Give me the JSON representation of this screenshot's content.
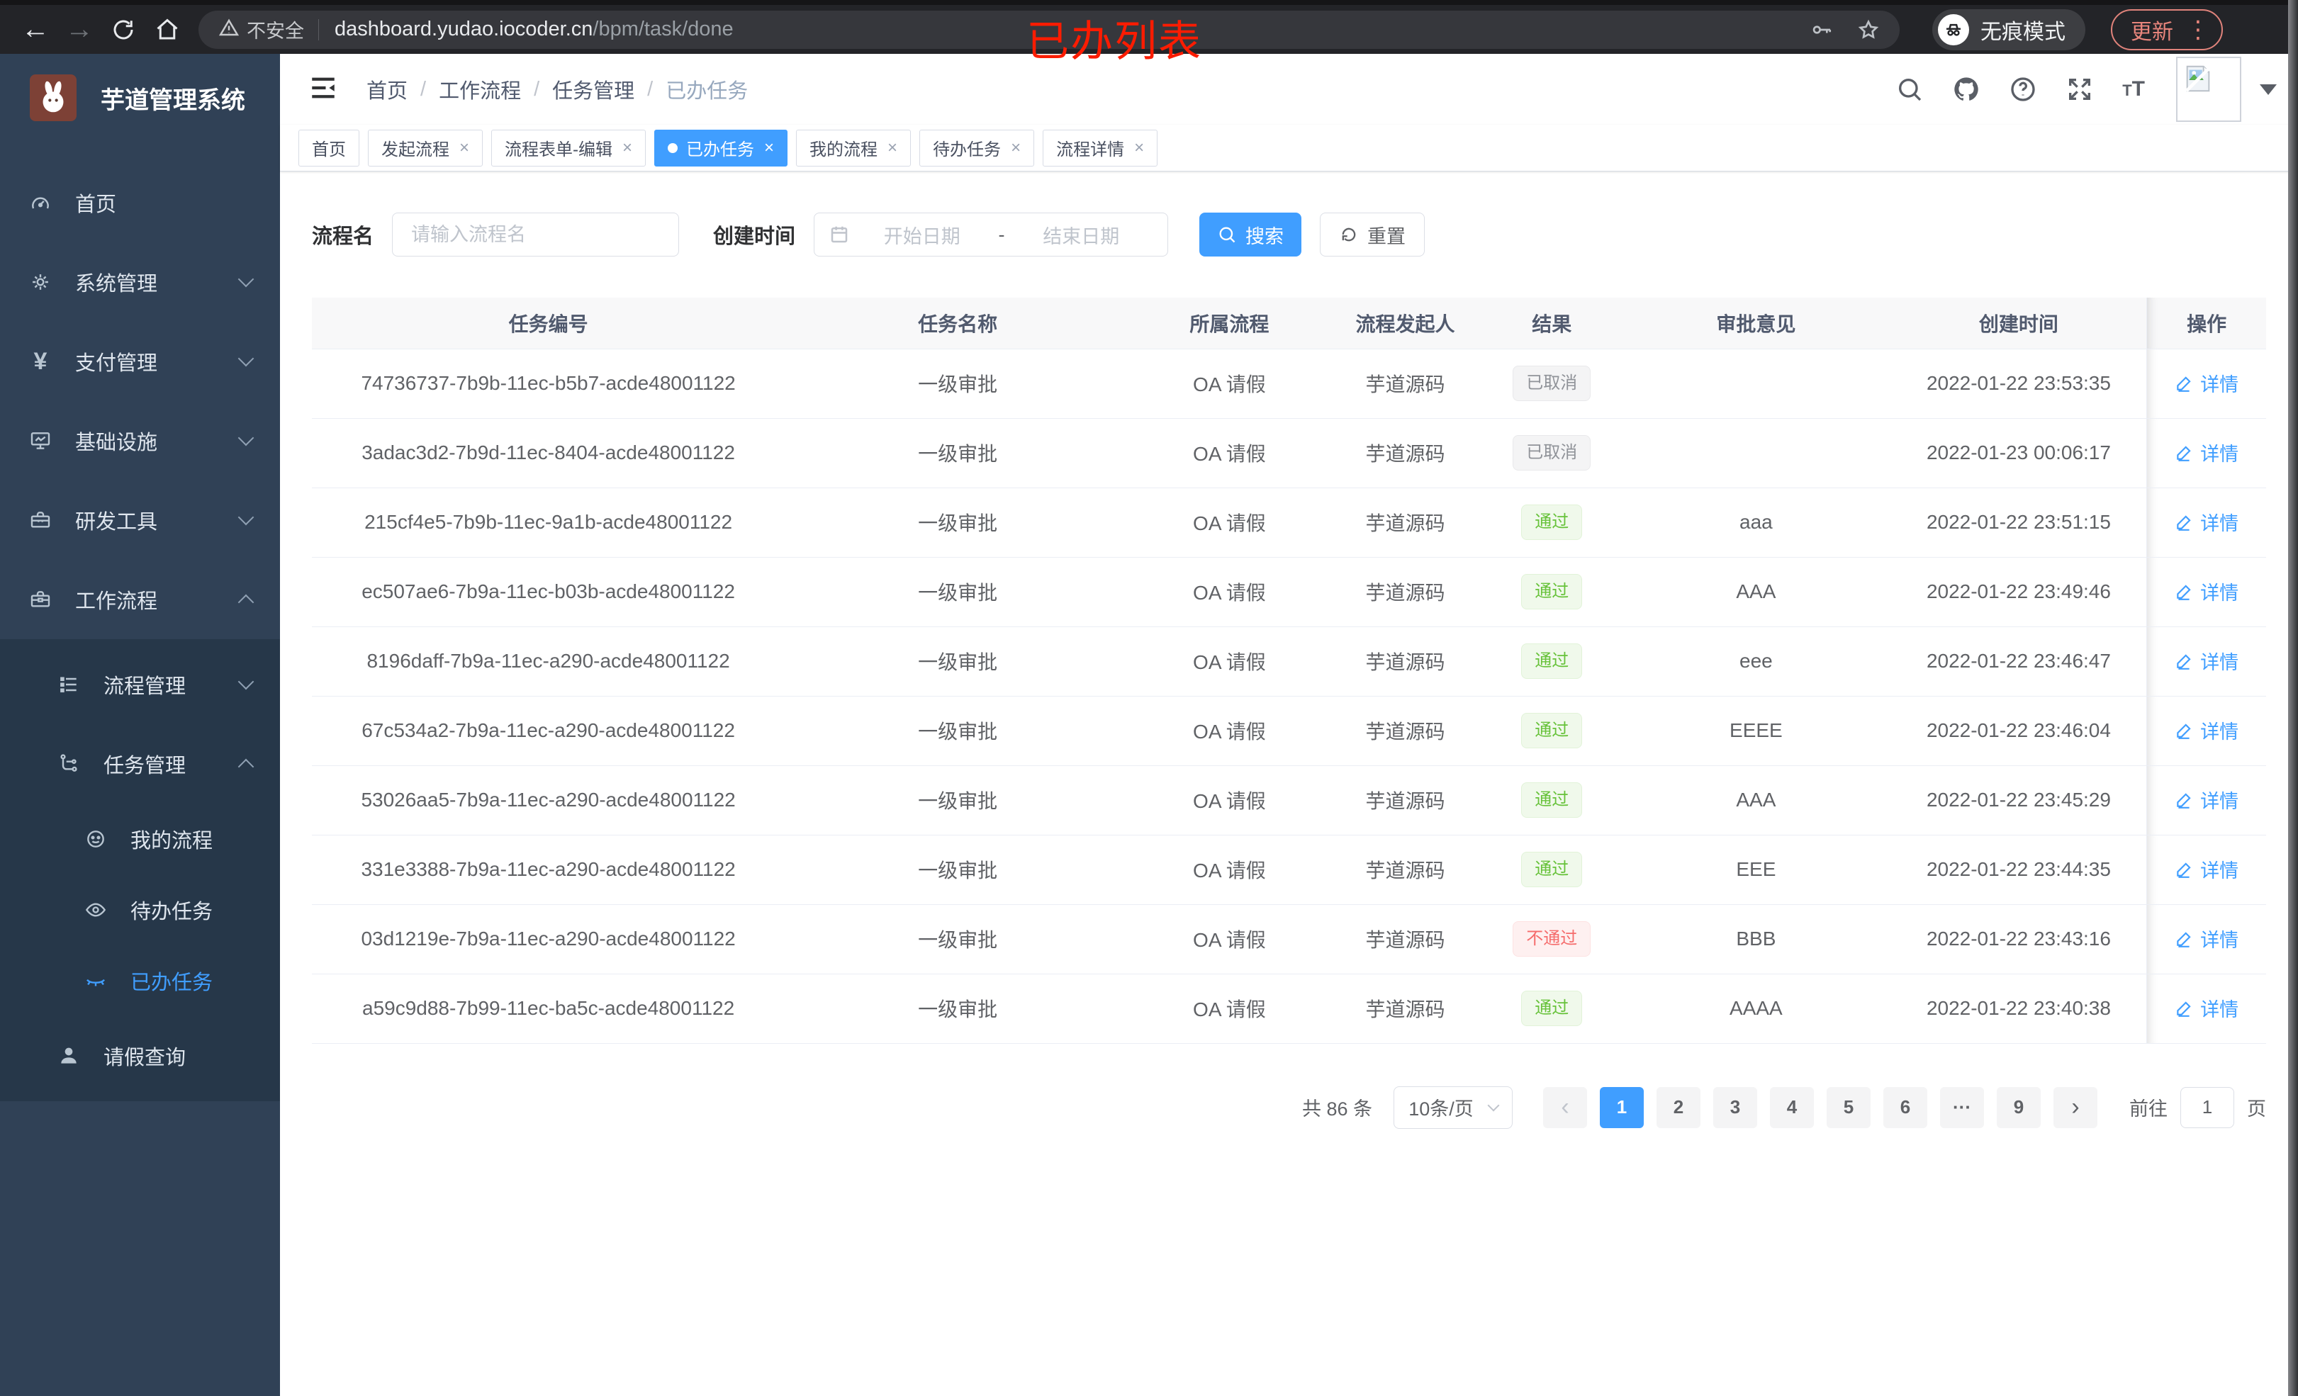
{
  "browser": {
    "security_label": "不安全",
    "url_host": "dashboard.yudao.iocoder.cn",
    "url_path": "/bpm/task/done",
    "incognito_label": "无痕模式",
    "update_label": "更新",
    "annotation": "已办列表"
  },
  "sidebar": {
    "logo_title": "芋道管理系统",
    "items": [
      {
        "label": "首页"
      },
      {
        "label": "系统管理"
      },
      {
        "label": "支付管理"
      },
      {
        "label": "基础设施"
      },
      {
        "label": "研发工具"
      },
      {
        "label": "工作流程"
      },
      {
        "label": "流程管理"
      },
      {
        "label": "任务管理"
      },
      {
        "label": "我的流程"
      },
      {
        "label": "待办任务"
      },
      {
        "label": "已办任务"
      },
      {
        "label": "请假查询"
      }
    ]
  },
  "topbar": {
    "breadcrumb": [
      "首页",
      "工作流程",
      "任务管理",
      "已办任务"
    ]
  },
  "tabs": [
    {
      "label": "首页"
    },
    {
      "label": "发起流程"
    },
    {
      "label": "流程表单-编辑"
    },
    {
      "label": "已办任务"
    },
    {
      "label": "我的流程"
    },
    {
      "label": "待办任务"
    },
    {
      "label": "流程详情"
    }
  ],
  "filter": {
    "name_label": "流程名",
    "name_placeholder": "请输入流程名",
    "time_label": "创建时间",
    "start_placeholder": "开始日期",
    "range_separator": "-",
    "end_placeholder": "结束日期",
    "search_label": "搜索",
    "reset_label": "重置"
  },
  "table": {
    "headers": [
      "任务编号",
      "任务名称",
      "所属流程",
      "流程发起人",
      "结果",
      "审批意见",
      "创建时间",
      "操作"
    ],
    "detail_label": "详情",
    "rows": [
      {
        "id": "74736737-7b9b-11ec-b5b7-acde48001122",
        "name": "一级审批",
        "process": "OA 请假",
        "starter": "芋道源码",
        "result": "已取消",
        "result_type": "cancel",
        "comment": "",
        "time": "2022-01-22 23:53:35"
      },
      {
        "id": "3adac3d2-7b9d-11ec-8404-acde48001122",
        "name": "一级审批",
        "process": "OA 请假",
        "starter": "芋道源码",
        "result": "已取消",
        "result_type": "cancel",
        "comment": "",
        "time": "2022-01-23 00:06:17"
      },
      {
        "id": "215cf4e5-7b9b-11ec-9a1b-acde48001122",
        "name": "一级审批",
        "process": "OA 请假",
        "starter": "芋道源码",
        "result": "通过",
        "result_type": "pass",
        "comment": "aaa",
        "time": "2022-01-22 23:51:15"
      },
      {
        "id": "ec507ae6-7b9a-11ec-b03b-acde48001122",
        "name": "一级审批",
        "process": "OA 请假",
        "starter": "芋道源码",
        "result": "通过",
        "result_type": "pass",
        "comment": "AAA",
        "time": "2022-01-22 23:49:46"
      },
      {
        "id": "8196daff-7b9a-11ec-a290-acde48001122",
        "name": "一级审批",
        "process": "OA 请假",
        "starter": "芋道源码",
        "result": "通过",
        "result_type": "pass",
        "comment": "eee",
        "time": "2022-01-22 23:46:47"
      },
      {
        "id": "67c534a2-7b9a-11ec-a290-acde48001122",
        "name": "一级审批",
        "process": "OA 请假",
        "starter": "芋道源码",
        "result": "通过",
        "result_type": "pass",
        "comment": "EEEE",
        "time": "2022-01-22 23:46:04"
      },
      {
        "id": "53026aa5-7b9a-11ec-a290-acde48001122",
        "name": "一级审批",
        "process": "OA 请假",
        "starter": "芋道源码",
        "result": "通过",
        "result_type": "pass",
        "comment": "AAA",
        "time": "2022-01-22 23:45:29"
      },
      {
        "id": "331e3388-7b9a-11ec-a290-acde48001122",
        "name": "一级审批",
        "process": "OA 请假",
        "starter": "芋道源码",
        "result": "通过",
        "result_type": "pass",
        "comment": "EEE",
        "time": "2022-01-22 23:44:35"
      },
      {
        "id": "03d1219e-7b9a-11ec-a290-acde48001122",
        "name": "一级审批",
        "process": "OA 请假",
        "starter": "芋道源码",
        "result": "不通过",
        "result_type": "fail",
        "comment": "BBB",
        "time": "2022-01-22 23:43:16"
      },
      {
        "id": "a59c9d88-7b99-11ec-ba5c-acde48001122",
        "name": "一级审批",
        "process": "OA 请假",
        "starter": "芋道源码",
        "result": "通过",
        "result_type": "pass",
        "comment": "AAAA",
        "time": "2022-01-22 23:40:38"
      }
    ]
  },
  "pagination": {
    "total": "共 86 条",
    "page_size": "10条/页",
    "pages": [
      "1",
      "2",
      "3",
      "4",
      "5",
      "6",
      "···",
      "9"
    ],
    "goto_label": "前往",
    "goto_value": "1",
    "page_unit": "页"
  }
}
